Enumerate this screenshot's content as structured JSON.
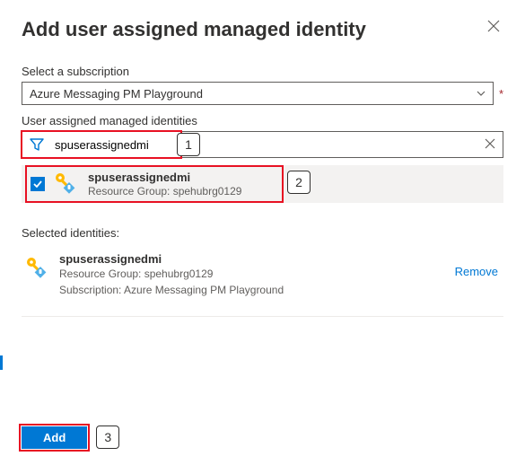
{
  "header": {
    "title": "Add user assigned managed identity"
  },
  "subscription": {
    "label": "Select a subscription",
    "value": "Azure Messaging PM Playground"
  },
  "identities": {
    "label": "User assigned managed identities",
    "filter_value": "spuserassignedmi",
    "result": {
      "name": "spuserassignedmi",
      "rg_line": "Resource Group: spehubrg0129"
    }
  },
  "selected": {
    "label": "Selected identities:",
    "item": {
      "name": "spuserassignedmi",
      "rg_line": "Resource Group: spehubrg0129",
      "sub_line": "Subscription: Azure Messaging PM Playground"
    },
    "remove": "Remove"
  },
  "footer": {
    "add": "Add"
  },
  "callouts": {
    "c1": "1",
    "c2": "2",
    "c3": "3"
  }
}
